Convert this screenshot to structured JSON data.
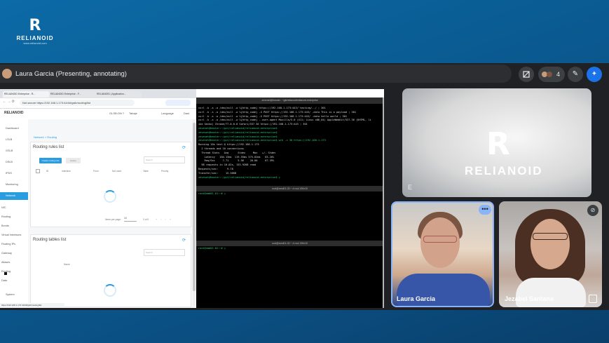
{
  "brand": {
    "mark": "R",
    "name": "RELIANOID",
    "url": "www.relianoid.com"
  },
  "meet": {
    "presenter_label": "Laura Garcia (Presenting, annotating)",
    "people_count": "4",
    "participants": [
      {
        "name": "E",
        "logo_mark": "R",
        "logo_text": "RELIANOID"
      },
      {
        "name": "Laura Garcia"
      },
      {
        "name": "Jezabel Santana"
      }
    ],
    "icons": {
      "layout": "layout-icon",
      "people": "people-icon",
      "annotate": "pen-icon",
      "ai": "sparkle-icon",
      "more": "more-icon",
      "muted": "mic-off-icon",
      "pin": "pin-icon"
    },
    "accent": "#8ab4f8"
  },
  "browser": {
    "tabs": [
      "RELIANOID Enterprise - R...",
      "RELIANOID Enterprise - F...",
      "RELIANOID | Application..."
    ],
    "url": "Not secure  https://192.168.1.173:444/#/gslb/routing/list",
    "status_url": "https://192.168.1.173:444/#/gslb/routing/list"
  },
  "app": {
    "logo": "RELIANOID",
    "header_items": [
      "GLSB:ON ?",
      "Tabaje",
      "Language",
      "Dani"
    ],
    "sidebar": [
      "Dashboard",
      "LSLB",
      "GSLB",
      "DSLB",
      "IPDS",
      "Monitoring",
      "Network",
      "NIC",
      "Routing",
      "Bonds",
      "Virtual Interfaces",
      "Floating IPs",
      "Gateway",
      "Aliases",
      "Routing",
      "Data",
      "System"
    ],
    "sidebar_active": "Network",
    "breadcrumb": "Network  >  Routing",
    "rules_title": "Routing rules list",
    "create_button": "Create routing rule",
    "delete_button": "Delete",
    "search_placeholder": "Search",
    "columns": [
      "ID",
      "Interface",
      "From",
      "Not used",
      "Table",
      "Priority"
    ],
    "pager": [
      "Items per page:",
      "10",
      "0 of 0"
    ],
    "tables_title": "Routing tables list",
    "tables_col": "Name"
  },
  "terminal1": {
    "title": "zevenet@hmster: ~/git/relianoid/relianoid-enterprise",
    "lines": [
      {
        "t": "curl -k -s -o /dev/null -w %{http_code} https://192.168.1.173:443/'testing/../ ; 301",
        "c": "#dcdcdc"
      },
      {
        "t": "curl -k -s -o /dev/null -w %{http_code} -X POST https://192.168.1.173:443/ -data This is a payload ; 301",
        "c": "#dcdcdc"
      },
      {
        "t": "curl -k -s -o /dev/null -w %{http_code} -X POST https://192.168.1.173:443/ -data hello world ; 301",
        "c": "#dcdcdc"
      },
      {
        "t": "curl -k -s -o /dev/null -w %{http_code} --user-agent Mozilla/5.0 (X11; Linux x86_64) AppleWebKit/537.36 (KHTML, li",
        "c": "#dcdcdc"
      },
      {
        "t": "ike Gecko) Chrome/77.0.0.0 Safari/537.36 https://192.168.1.173:443 ; 301",
        "c": "#dcdcdc"
      },
      {
        "t": "zevenet@hmster:~/git/relianoid/relianoid-enterprise$",
        "c": "#33d17a"
      },
      {
        "t": "zevenet@hmster:~/git/relianoid/relianoid-enterprise$",
        "c": "#33d17a"
      },
      {
        "t": "zevenet@hmster:~/git/relianoid/relianoid-enterprise$",
        "c": "#33d17a"
      },
      {
        "t": "zevenet@hmster:~/git/relianoid/relianoid-enterprise$ wrk -c 30 https://192.168.1.173",
        "c": "#33d17a"
      },
      {
        "t": "Running 10s test @ https://192.168.1.173",
        "c": "#dcdcdc"
      },
      {
        "t": "  2 threads and 10 connections",
        "c": "#dcdcdc"
      },
      {
        "t": "  Thread Stats   Avg      Stdev     Max   +/- Stdev",
        "c": "#dcdcdc"
      },
      {
        "t": "    Latency   184.13ms  119.55ms 575.02ms   63.20%",
        "c": "#dcdcdc"
      },
      {
        "t": "    Req/Sec     7.71      5.56    20.00     67.39%",
        "c": "#dcdcdc"
      },
      {
        "t": "  98 requests in 10.02s, 153.92KB read",
        "c": "#dcdcdc"
      },
      {
        "t": "Requests/sec:      9.78",
        "c": "#dcdcdc"
      },
      {
        "t": "Transfer/sec:     15.36KB",
        "c": "#dcdcdc"
      },
      {
        "t": "zevenet@hmster:~/git/relianoid/relianoid-enterprise$ ▯",
        "c": "#33d17a"
      }
    ]
  },
  "terminal2": {
    "title": "root@nmd01-02:~  # rout 190x15",
    "prompt": "root@nmd01-01:~# ▯"
  },
  "terminal3": {
    "title": "root@nmd01-02:~  # rout 190x15",
    "prompt": "root@nmd01-02:~# ▯"
  }
}
